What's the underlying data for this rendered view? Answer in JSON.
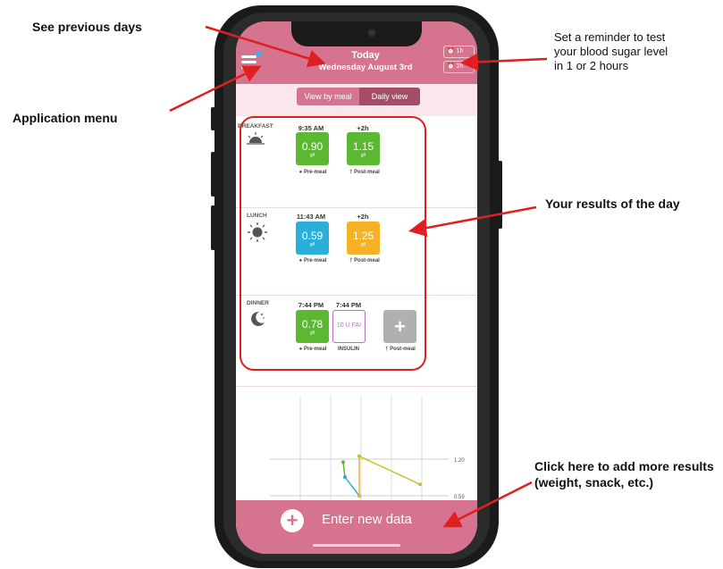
{
  "callouts": {
    "previous_days": "See previous days",
    "reminder_line1": "Set a reminder to test",
    "reminder_line2": "your blood sugar level",
    "reminder_line3": "in 1 or 2 hours",
    "app_menu": "Application menu",
    "results": "Your results of the day",
    "add_more_line1": "Click here to add more results",
    "add_more_line2": "(weight, snack, etc.)"
  },
  "header": {
    "title": "Today",
    "date": "Wednesday August 3rd",
    "alarm_1h": "1h",
    "alarm_2h": "2h"
  },
  "view_toggle": {
    "by_meal": "View by meal",
    "daily": "Daily view",
    "selected": "Daily view"
  },
  "meals": [
    {
      "name": "BREAKFAST",
      "icon": "sunrise-icon",
      "pre_time": "9:35 AM",
      "post_time": "+2h",
      "pre_value": "0.90",
      "post_value": "1.15",
      "unit": "g/l",
      "pre_label": "Pre-meal",
      "post_label": "Post-meal"
    },
    {
      "name": "LUNCH",
      "icon": "sun-icon",
      "pre_time": "11:43 AM",
      "post_time": "+2h",
      "pre_value": "0.59",
      "post_value": "1.25",
      "unit": "g/l",
      "pre_label": "Pre-meal",
      "post_label": "Post-meal"
    },
    {
      "name": "DINNER",
      "icon": "moon-icon",
      "pre_time": "7:44 PM",
      "insulin_time": "7:44 PM",
      "pre_value": "0.78",
      "insulin_value": "10 U FAI",
      "unit": "g/l",
      "pre_label": "Pre-meal",
      "insulin_label": "INSULIN",
      "post_label": "Post-meal"
    }
  ],
  "chart_data": {
    "type": "line",
    "y_ticks": [
      "1.20",
      "0.59"
    ],
    "series": [
      {
        "color": "#5cb832",
        "points": [
          1.15,
          0.9
        ]
      },
      {
        "color": "#2ab0d8",
        "points": [
          0.9,
          0.59
        ]
      },
      {
        "color": "#e8b23a",
        "points": [
          1.25,
          0.59
        ]
      },
      {
        "color": "#c7c230",
        "points": [
          1.25,
          0.78
        ]
      }
    ]
  },
  "footer": {
    "label": "Enter new data"
  },
  "colors": {
    "brand": "#d6738f",
    "green": "#5cb832",
    "blue": "#2ab0d8",
    "orange": "#f6b227",
    "gray": "#b0b0b0",
    "annotation": "#e02020"
  }
}
